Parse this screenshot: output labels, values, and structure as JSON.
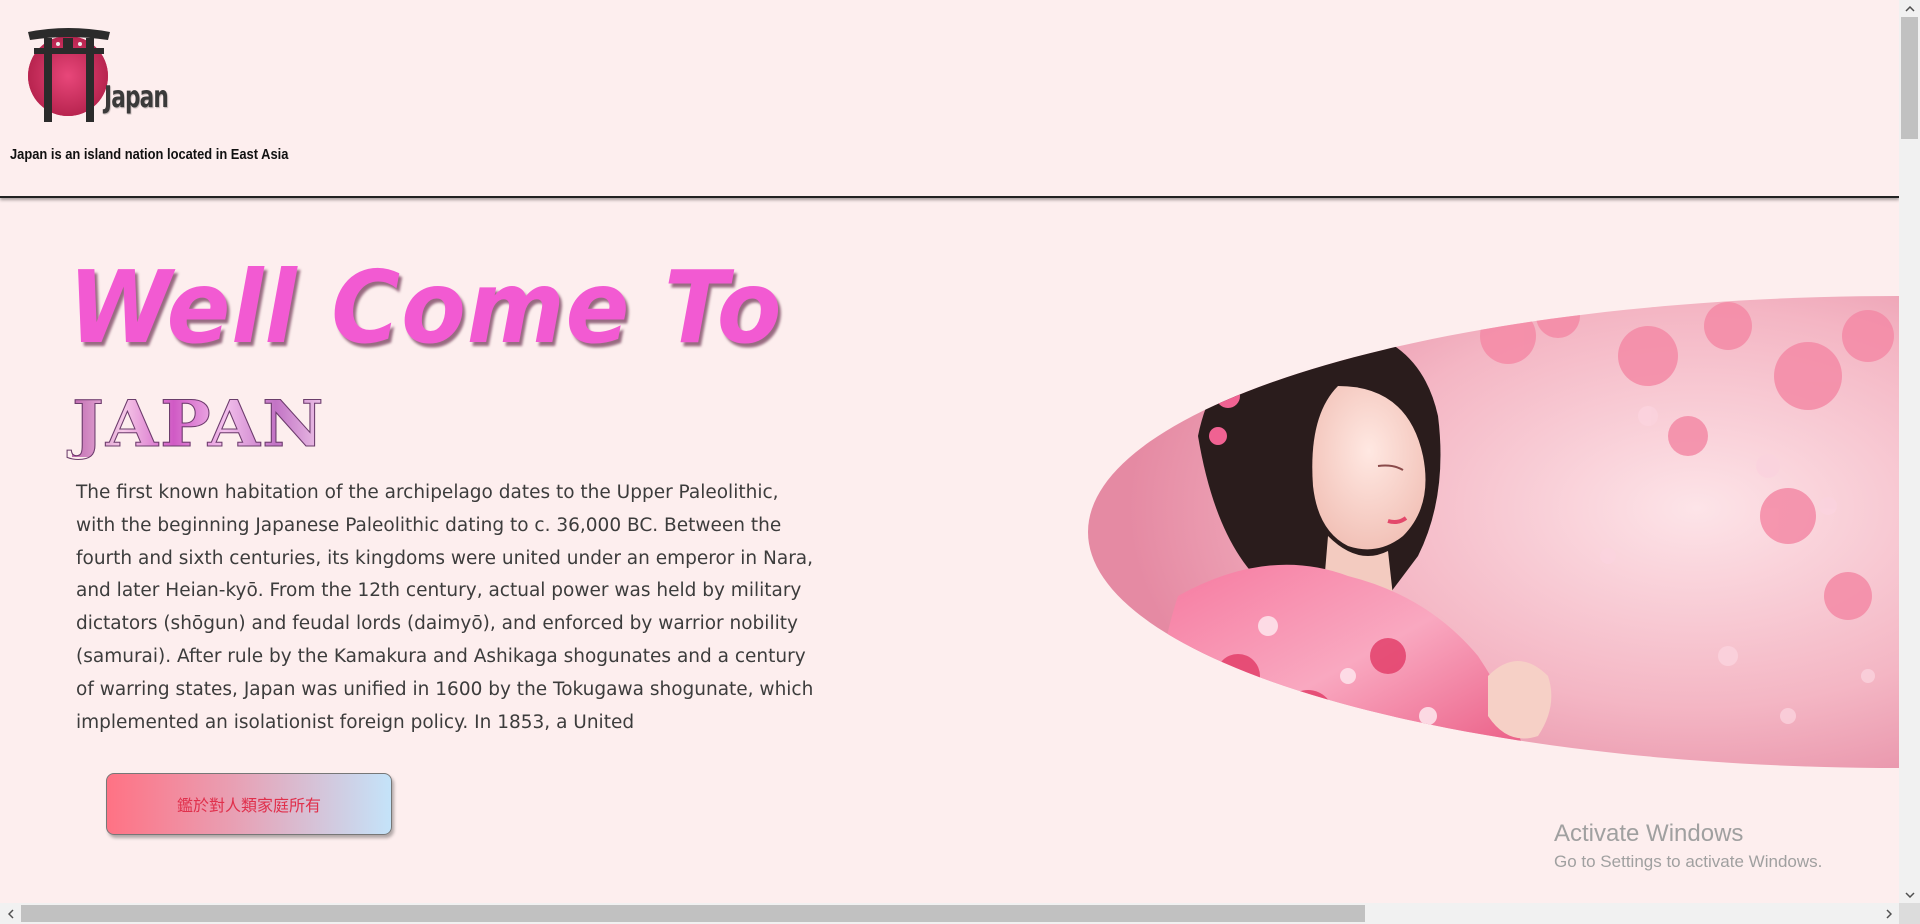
{
  "header": {
    "logo_text": "Japan",
    "tagline": "Japan is an island nation located in East Asia"
  },
  "hero": {
    "title": "Well Come To",
    "subtitle": "JAPAN",
    "body": "The first known habitation of the archipelago dates to the Upper Paleolithic, with the beginning Japanese Paleolithic dating to c. 36,000 BC. Between the fourth and sixth centuries, its kingdoms were united under an emperor in Nara, and later Heian-kyō. From the 12th century, actual power was held by military dictators (shōgun) and feudal lords (daimyō), and enforced by warrior nobility (samurai). After rule by the Kamakura and Ashikaga shogunates and a century of warring states, Japan was unified in 1600 by the Tokugawa shogunate, which implemented an isolationist foreign policy. In 1853, a United",
    "button_label": "鑑於對人類家庭所有",
    "image_icon": "woman-in-kimono-cherry-blossoms-image"
  },
  "watermark": {
    "title": "Activate Windows",
    "subtitle": "Go to Settings to activate Windows."
  },
  "colors": {
    "background": "#fdeeee",
    "title_pink": "#f25ad2",
    "button_text": "#e0304c"
  }
}
